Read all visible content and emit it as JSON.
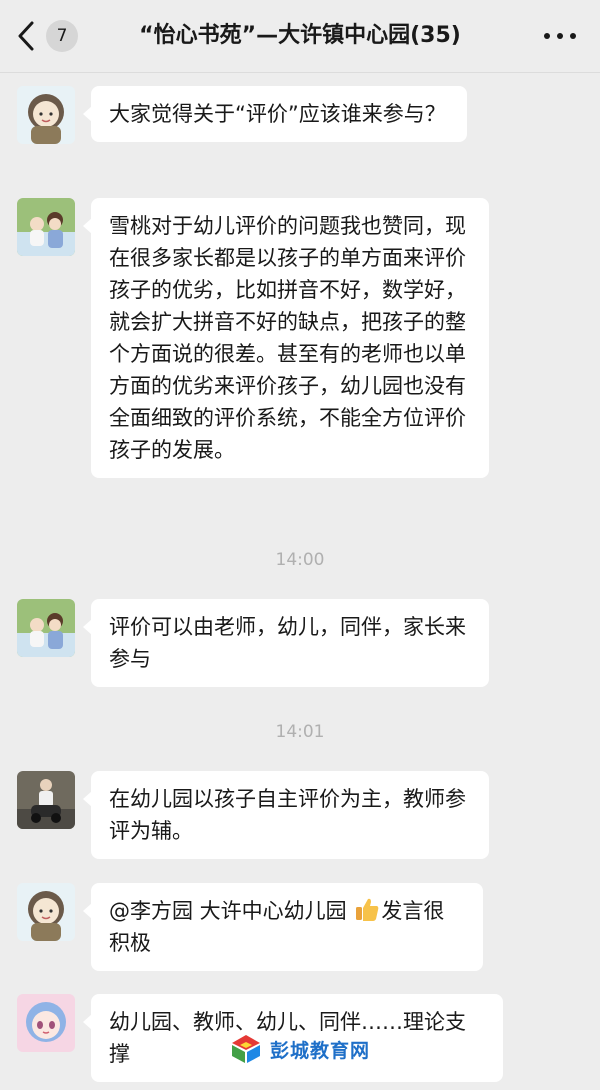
{
  "header": {
    "back_label": "back",
    "unread_count": "7",
    "title": "“怡心书苑”—大许镇中心园(35)",
    "more_label": "more"
  },
  "messages": [
    {
      "avatar": "avatar-cartoon-girl",
      "text": "大家觉得关于“评价”应该谁来参与？"
    },
    {
      "avatar": "avatar-two-children",
      "text": "雪桃对于幼儿评价的问题我也赞同，现在很多家长都是以孩子的单方面来评价孩子的优劣，比如拼音不好，数学好，就会扩大拼音不好的缺点，把孩子的整个方面说的很差。甚至有的老师也以单方面的优劣来评价孩子，幼儿园也没有全面细致的评价系统，不能全方位评价孩子的发展。"
    },
    {
      "time": "14:00"
    },
    {
      "avatar": "avatar-two-children",
      "text": "评价可以由老师，幼儿，同伴，家长来参与"
    },
    {
      "time": "14:01"
    },
    {
      "avatar": "avatar-child-on-toy-car",
      "text": "在幼儿园以孩子自主评价为主，教师参评为辅。"
    },
    {
      "avatar": "avatar-cartoon-girl",
      "text_before": "@李方园 大许中心幼儿园 ",
      "emoji": "thumbs-up-icon",
      "text_after": "发言很积极"
    },
    {
      "avatar": "avatar-anime-girl",
      "text": "幼儿园、教师、幼儿、同伴……理论支撑"
    }
  ],
  "watermark": {
    "text": "彭城教育网"
  },
  "colors": {
    "background": "#ededed",
    "bubble": "#ffffff",
    "text": "#191919",
    "time": "#b0b0b0",
    "watermark": "#1e6fc8"
  }
}
